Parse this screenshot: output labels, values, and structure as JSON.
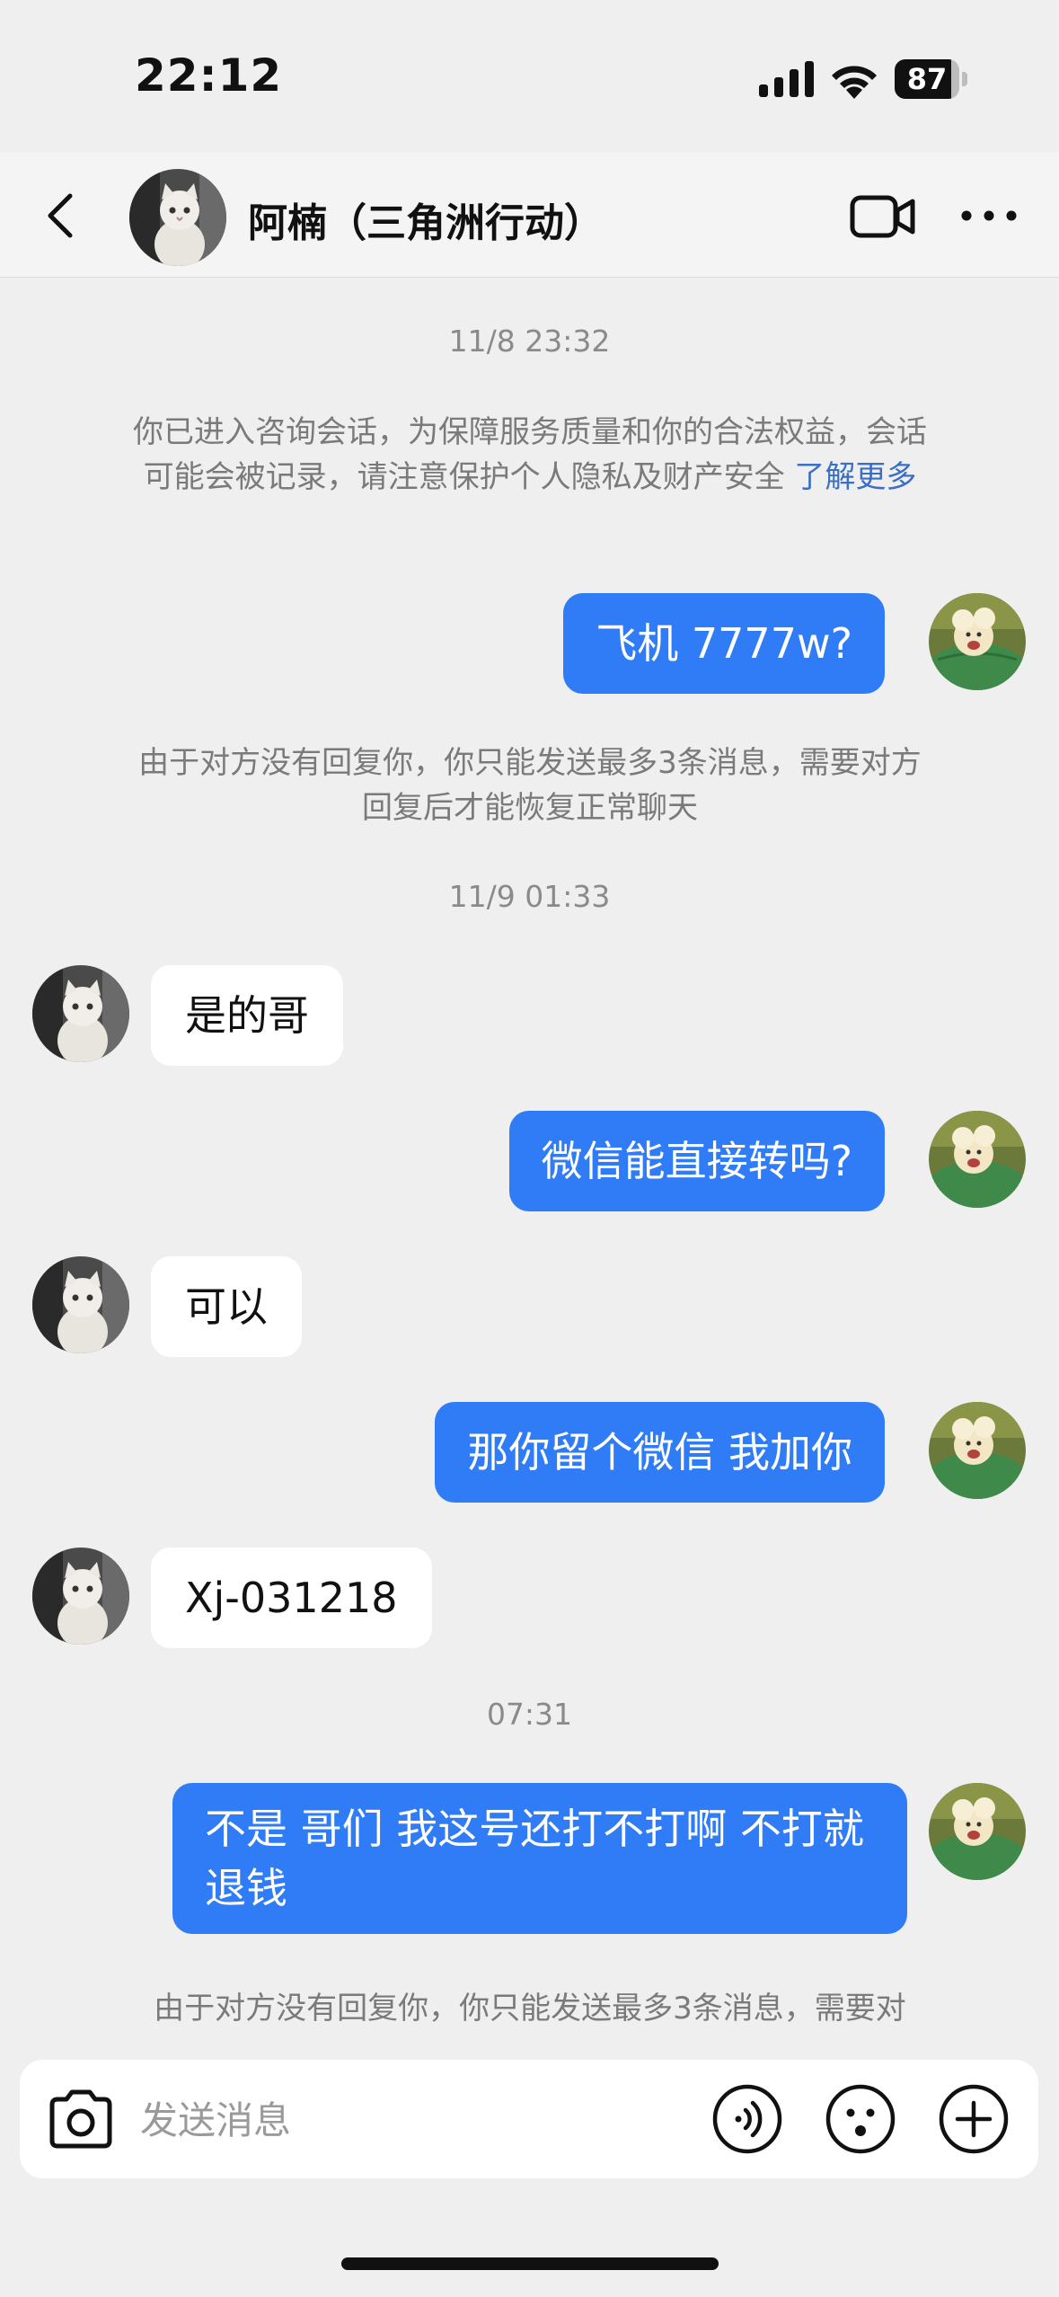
{
  "status_bar": {
    "time": "22:12",
    "battery_level": "87",
    "battery_fraction": 0.87,
    "icons": [
      "signal-icon",
      "wifi-icon",
      "battery-icon"
    ]
  },
  "nav": {
    "title": "阿楠（三角洲行动）",
    "icons": [
      "back-chevron-icon",
      "contact-avatar",
      "video-call-icon",
      "more-icon"
    ]
  },
  "chat": {
    "timestamps": [
      "11/8 23:32",
      "11/9 01:33",
      "07:31"
    ],
    "notice": {
      "text": "你已进入咨询会话，为保障服务质量和你的合法权益，会话可能会被记录，请注意保护个人隐私及财产安全",
      "link": "了解更多"
    },
    "limit_notice": "由于对方没有回复你，你只能发送最多3条消息，需要对方回复后才能恢复正常聊天",
    "limit_notice_partial": "由于对方没有回复你，你只能发送最多3条消息，需要对",
    "messages": [
      {
        "side": "out",
        "text": "飞机 7777w?"
      },
      {
        "side": "in",
        "text": "是的哥"
      },
      {
        "side": "out",
        "text": "微信能直接转吗?"
      },
      {
        "side": "in",
        "text": "可以"
      },
      {
        "side": "out",
        "text": "那你留个微信 我加你"
      },
      {
        "side": "in",
        "text": "Xj-031218"
      },
      {
        "side": "out",
        "text": "不是 哥们 我这号还打不打啊 不打就退钱"
      }
    ]
  },
  "input": {
    "placeholder": "发送消息",
    "icons": [
      "camera-icon",
      "voice-icon",
      "emoji-icon",
      "plus-icon"
    ]
  },
  "colors": {
    "outgoing_bubble": "#2f7cf6",
    "incoming_bubble": "#ffffff",
    "background": "#efefef",
    "link": "#3b6fc2"
  }
}
